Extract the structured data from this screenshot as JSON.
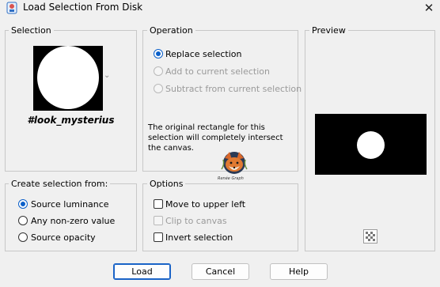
{
  "window": {
    "title": "Load Selection From Disk",
    "close_glyph": "✕"
  },
  "selection": {
    "group_label": "Selection",
    "name": "#look_mysterius",
    "dropdown_glyph": "⌄"
  },
  "operation": {
    "group_label": "Operation",
    "options": [
      {
        "label": "Replace selection",
        "checked": true,
        "enabled": true
      },
      {
        "label": "Add to current selection",
        "checked": false,
        "enabled": false
      },
      {
        "label": "Subtract from current selection",
        "checked": false,
        "enabled": false
      }
    ],
    "note_lines": [
      "The original rectangle for this",
      "selection will completely intersect",
      "the canvas."
    ],
    "watermark_text": "Renée Graph"
  },
  "preview": {
    "group_label": "Preview",
    "checker_icon": "checkerboard-icon"
  },
  "create_from": {
    "group_label": "Create selection from:",
    "options": [
      {
        "label": "Source luminance",
        "checked": true
      },
      {
        "label": "Any non-zero value",
        "checked": false
      },
      {
        "label": "Source opacity",
        "checked": false
      }
    ]
  },
  "options": {
    "group_label": "Options",
    "items": [
      {
        "label": "Move to upper left",
        "checked": false,
        "enabled": true
      },
      {
        "label": "Clip to canvas",
        "checked": false,
        "enabled": false
      },
      {
        "label": "Invert selection",
        "checked": false,
        "enabled": true
      }
    ]
  },
  "buttons": {
    "load": "Load",
    "cancel": "Cancel",
    "help": "Help"
  },
  "colors": {
    "accent": "#0a5fc9",
    "background": "#f0f0f0",
    "group_border": "#c8c8c8"
  }
}
